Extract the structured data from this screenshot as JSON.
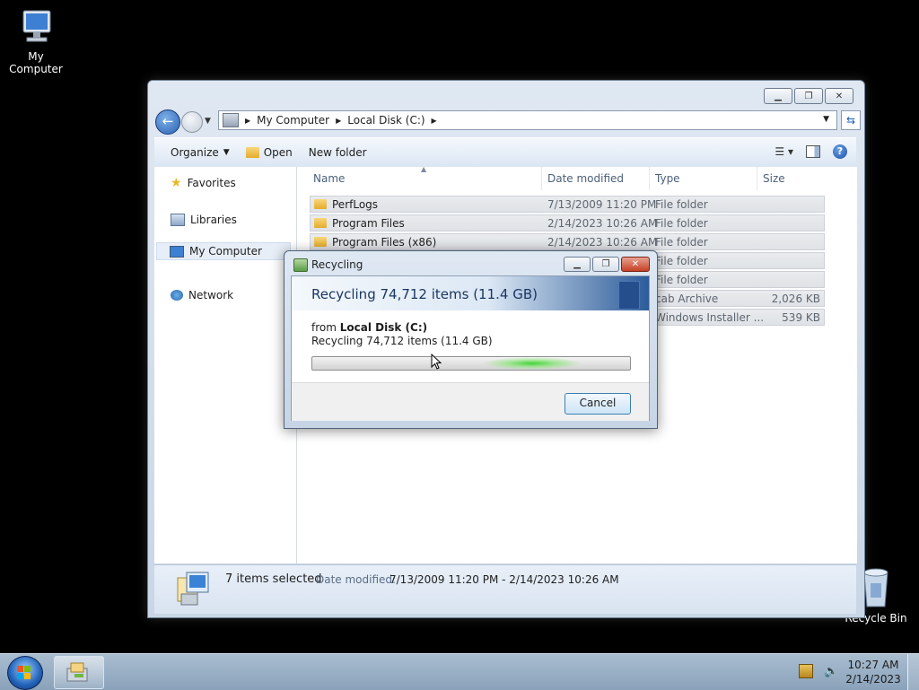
{
  "desktop": {
    "icons": [
      {
        "label": "My Computer",
        "icon": "computer-icon"
      },
      {
        "label": "Recycle Bin",
        "icon": "recycle-bin-icon"
      }
    ]
  },
  "explorer": {
    "breadcrumb": [
      "My Computer",
      "Local Disk (C:)"
    ],
    "toolbar": {
      "organize": "Organize",
      "open": "Open",
      "new_folder": "New folder"
    },
    "nav": [
      "Favorites",
      "Libraries",
      "My Computer",
      "Network"
    ],
    "selected_nav": "My Computer",
    "columns": {
      "name": "Name",
      "date": "Date modified",
      "type": "Type",
      "size": "Size"
    },
    "rows": [
      {
        "name": "PerfLogs",
        "date": "7/13/2009 11:20 PM",
        "type": "File folder",
        "size": ""
      },
      {
        "name": "Program Files",
        "date": "2/14/2023 10:26 AM",
        "type": "File folder",
        "size": ""
      },
      {
        "name": "Program Files (x86)",
        "date": "2/14/2023 10:26 AM",
        "type": "File folder",
        "size": ""
      },
      {
        "name": "",
        "date": "",
        "type": "File folder",
        "size": ""
      },
      {
        "name": "",
        "date": "",
        "type": "File folder",
        "size": ""
      },
      {
        "name": "",
        "date": "",
        "type": "cab Archive",
        "size": "2,026 KB"
      },
      {
        "name": "",
        "date": "",
        "type": "Windows Installer ...",
        "size": "539 KB"
      }
    ],
    "details": {
      "selected": "7 items selected",
      "date_label": "Date modified:",
      "date_value": "7/13/2009 11:20 PM - 2/14/2023 10:26 AM"
    }
  },
  "dialog": {
    "title": "Recycling",
    "heading": "Recycling 74,712 items (11.4 GB)",
    "from_label": "from",
    "from_location": "Local Disk (C:)",
    "subtext": "Recycling 74,712 items (11.4 GB)",
    "cancel": "Cancel"
  },
  "taskbar": {
    "time": "10:27 AM",
    "date": "2/14/2023"
  },
  "colors": {
    "accent": "#2a61b5",
    "close": "#c64026",
    "progress_glow": "#44d43a"
  }
}
